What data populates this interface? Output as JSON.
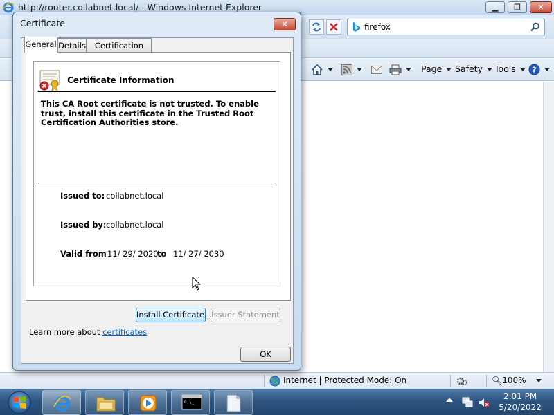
{
  "browser": {
    "window_title": "http://router.collabnet.local/ - Windows Internet Explorer",
    "search_value": "firefox",
    "command_bar": {
      "page_label": "Page",
      "safety_label": "Safety",
      "tools_label": "Tools"
    },
    "status": {
      "zone_text": "Internet | Protected Mode: On",
      "zoom_text": "100%"
    }
  },
  "dialog": {
    "title": "Certificate",
    "tabs": [
      "General",
      "Details",
      "Certification Path"
    ],
    "active_tab": "General",
    "info_heading": "Certificate Information",
    "message": "This CA Root certificate is not trusted. To enable trust, install this certificate in the Trusted Root Certification Authorities store.",
    "issued_to_label": "Issued to:",
    "issued_to": "collabnet.local",
    "issued_by_label": "Issued by:",
    "issued_by": "collabnet.local",
    "valid_from_label": "Valid from",
    "valid_from": "11/ 29/ 2020",
    "valid_to_label": "to",
    "valid_to": "11/ 27/ 2030",
    "install_button": "Install Certificate...",
    "issuer_button": "Issuer Statement",
    "learn_more_text": "Learn more about",
    "learn_more_link": "certificates",
    "ok_button": "OK"
  },
  "taskbar": {
    "time": "2:01 PM",
    "date": "5/20/2022"
  },
  "colors": {
    "link": "#0066cc",
    "taskbar": "#2c5480",
    "dialog_frame": "#c9dbef"
  }
}
